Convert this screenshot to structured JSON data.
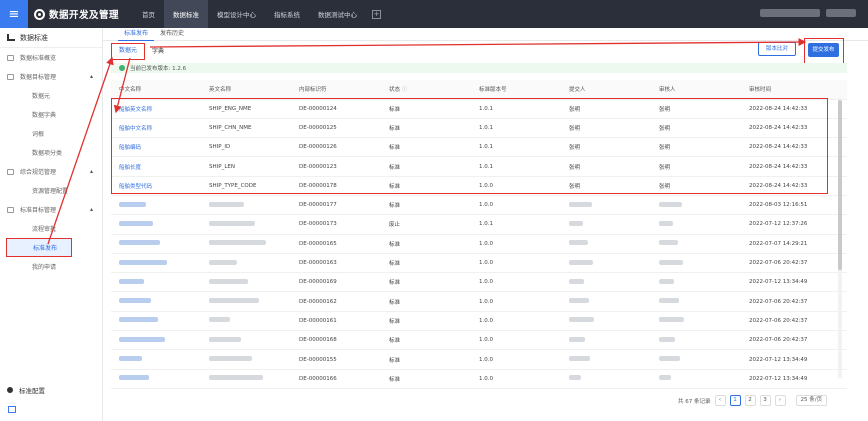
{
  "app": {
    "title": "数据开发及管理",
    "menu_icon": "menu-icon"
  },
  "nav": [
    "首页",
    "数据标准",
    "模型设计中心",
    "指标系统",
    "数据测试中心"
  ],
  "sidebar": {
    "title": "数据标准",
    "items": [
      {
        "label": "数据标准概览"
      },
      {
        "label": "数据目标管理"
      }
    ],
    "sub1": [
      "数据元",
      "数据字典",
      "词根",
      "数据项分类"
    ],
    "item3": "综合规范管理",
    "sub2": [
      "资源管理配置"
    ],
    "item4": "标准目标管理",
    "sub3": [
      "流程审批",
      "标准发布",
      "我的申请"
    ],
    "bottom": "标准配置"
  },
  "tabs": [
    "标准发布",
    "发布历史"
  ],
  "subtabs": [
    "数据元",
    "字典"
  ],
  "buttons": {
    "advanced": "版本比对",
    "submit": "提交发布"
  },
  "version_bar": "当前已发布版本: 1.2.6",
  "table": {
    "headers": [
      "中文名称",
      "英文名称",
      "内部标识符",
      "状态",
      "标准版本号",
      "提交人",
      "审核人",
      "审核时间"
    ],
    "rows": [
      [
        "船舶英文名称",
        "SHIP_ENG_NME",
        "DE-00000124",
        "标准",
        "1.0.1",
        "张明",
        "张明",
        "2022-08-24 14:42:33"
      ],
      [
        "船舶中文名称",
        "SHIP_CHN_NME",
        "DE-00000125",
        "标准",
        "1.0.1",
        "张明",
        "张明",
        "2022-08-24 14:42:33"
      ],
      [
        "船舶编码",
        "SHIP_ID",
        "DE-00000126",
        "标准",
        "1.0.1",
        "张明",
        "张明",
        "2022-08-24 14:42:33"
      ],
      [
        "船舶长度",
        "SHIP_LEN",
        "DE-00000123",
        "标准",
        "1.0.1",
        "张明",
        "张明",
        "2022-08-24 14:42:33"
      ],
      [
        "船舶类型代码",
        "SHIP_TYPE_CODE",
        "DE-00000178",
        "标准",
        "1.0.0",
        "张明",
        "张明",
        "2022-08-24 14:42:33"
      ],
      [
        "",
        "",
        "DE-00000177",
        "标准",
        "1.0.0",
        "",
        "",
        "2022-08-03 12:16:51"
      ],
      [
        "",
        "",
        "DE-00000173",
        "废止",
        "1.0.1",
        "",
        "",
        "2022-07-12 12:37:26"
      ],
      [
        "",
        "",
        "DE-00000165",
        "标准",
        "1.0.0",
        "",
        "",
        "2022-07-07 14:29:21"
      ],
      [
        "",
        "",
        "DE-00000163",
        "标准",
        "1.0.0",
        "",
        "",
        "2022-07-06 20:42:37"
      ],
      [
        "",
        "",
        "DE-00000169",
        "标准",
        "1.0.0",
        "",
        "",
        "2022-07-12 13:34:49"
      ],
      [
        "",
        "",
        "DE-00000162",
        "标准",
        "1.0.0",
        "",
        "",
        "2022-07-06 20:42:37"
      ],
      [
        "",
        "",
        "DE-00000161",
        "标准",
        "1.0.0",
        "",
        "",
        "2022-07-06 20:42:37"
      ],
      [
        "",
        "",
        "DE-00000168",
        "标准",
        "1.0.0",
        "",
        "",
        "2022-07-06 20:42:37"
      ],
      [
        "",
        "",
        "DE-00000155",
        "标准",
        "1.0.0",
        "",
        "",
        "2022-07-12 13:34:49"
      ],
      [
        "",
        "",
        "DE-00000166",
        "标准",
        "1.0.0",
        "",
        "",
        "2022-07-12 13:34:49"
      ]
    ]
  },
  "pager": {
    "total": "共 67 条记录",
    "pages": [
      "1",
      "2",
      "3"
    ],
    "size": "25 条/页"
  },
  "colors": {
    "primary": "#2f6fe0",
    "annotation": "#e0312f",
    "topbar": "#2b2f3a"
  }
}
